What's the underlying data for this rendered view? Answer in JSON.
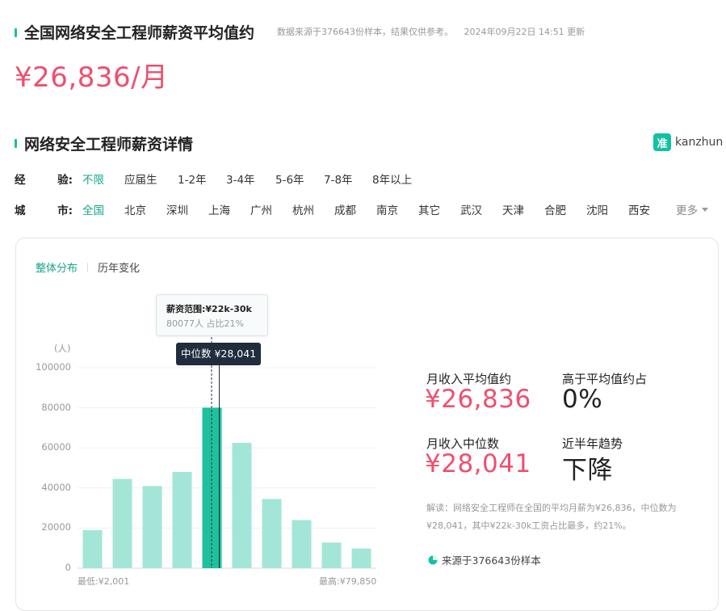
{
  "header": {
    "title": "全国网络安全工程师薪资平均值约",
    "meta_source": "数据来源于376643份样本，结果仅供参考。",
    "meta_time": "2024年09月22日 14:51 更新",
    "big_price": "¥26,836/月"
  },
  "section": {
    "title": "网络安全工程师薪资详情",
    "logo_mark": "准",
    "logo_text": "kanzhun"
  },
  "filters": {
    "experience": {
      "label_a": "经",
      "label_b": "验:",
      "options": [
        "不限",
        "应届生",
        "1-2年",
        "3-4年",
        "5-6年",
        "7-8年",
        "8年以上"
      ],
      "active": "不限"
    },
    "city": {
      "label_a": "城",
      "label_b": "市:",
      "options": [
        "全国",
        "北京",
        "深圳",
        "上海",
        "广州",
        "杭州",
        "成都",
        "南京",
        "其它",
        "武汉",
        "天津",
        "合肥",
        "沈阳",
        "西安"
      ],
      "active": "全国",
      "more": "更多"
    }
  },
  "tabs": {
    "overall": "整体分布",
    "history": "历年变化",
    "active": "整体分布"
  },
  "chart_data": {
    "type": "bar",
    "unit_label": "(人)",
    "yticks": [
      "100000",
      "80000",
      "60000",
      "40000",
      "20000",
      "0"
    ],
    "ylim": [
      0,
      100000
    ],
    "values": [
      19000,
      44500,
      41000,
      48000,
      80077,
      62500,
      34500,
      24000,
      12800,
      9800
    ],
    "highlight_index": 4,
    "x_min_label": "最低:¥2,001",
    "x_max_label": "最高:¥79,850",
    "colors": {
      "bar": "#a3e6d7",
      "highlight": "#1ec09e"
    },
    "tooltip": {
      "range": "薪资范围:¥22k-30k",
      "detail": "80077人  占比21%"
    },
    "median_tip": "中位数 ¥28,041"
  },
  "stats": {
    "avg_label": "月收入平均值约",
    "avg_value": "¥26,836",
    "above_label": "高于平均值约占",
    "above_value": "0%",
    "median_label": "月收入中位数",
    "median_value": "¥28,041",
    "trend_label": "近半年趋势",
    "trend_value": "下降",
    "note": "解读：网络安全工程师在全国的平均月薪为¥26,836，中位数为¥28,041，其中¥22k-30k工资占比最多，约21%。",
    "source": "来源于376643份样本"
  },
  "colors": {
    "accent": "#14c0a3",
    "price": "#ef4f6e",
    "active_text": "#14a58a"
  }
}
